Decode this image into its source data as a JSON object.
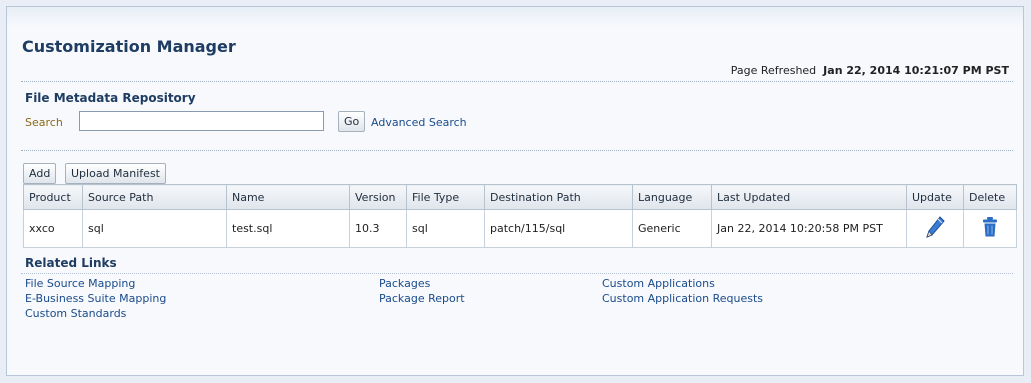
{
  "page": {
    "title": "Customization Manager",
    "refresh_label": "Page Refreshed",
    "refresh_time": "Jan 22, 2014 10:21:07 PM PST"
  },
  "repository": {
    "title": "File Metadata Repository",
    "search_label": "Search",
    "search_value": "",
    "go_label": "Go",
    "advanced_search": "Advanced Search"
  },
  "toolbar": {
    "add_label": "Add",
    "upload_label": "Upload Manifest"
  },
  "table": {
    "headers": [
      "Product",
      "Source Path",
      "Name",
      "Version",
      "File Type",
      "Destination Path",
      "Language",
      "Last Updated",
      "Update",
      "Delete"
    ],
    "rows": [
      {
        "product": "xxco",
        "source_path": "sql",
        "name": "test.sql",
        "version": "10.3",
        "file_type": "sql",
        "destination_path": "patch/115/sql",
        "language": "Generic",
        "last_updated": "Jan 22, 2014 10:20:58 PM PST",
        "update_icon": "pencil-icon",
        "delete_icon": "trash-icon"
      }
    ]
  },
  "related": {
    "title": "Related Links",
    "col1": [
      "File Source Mapping",
      "E-Business Suite Mapping",
      "Custom Standards"
    ],
    "col2": [
      "Packages",
      "Package Report"
    ],
    "col3": [
      "Custom Applications",
      "Custom Application Requests"
    ]
  },
  "colors": {
    "title": "#1f3c63",
    "link": "#1a4b8c",
    "search_label": "#8a6a1a",
    "icon_blue": "#2b6cc4"
  }
}
